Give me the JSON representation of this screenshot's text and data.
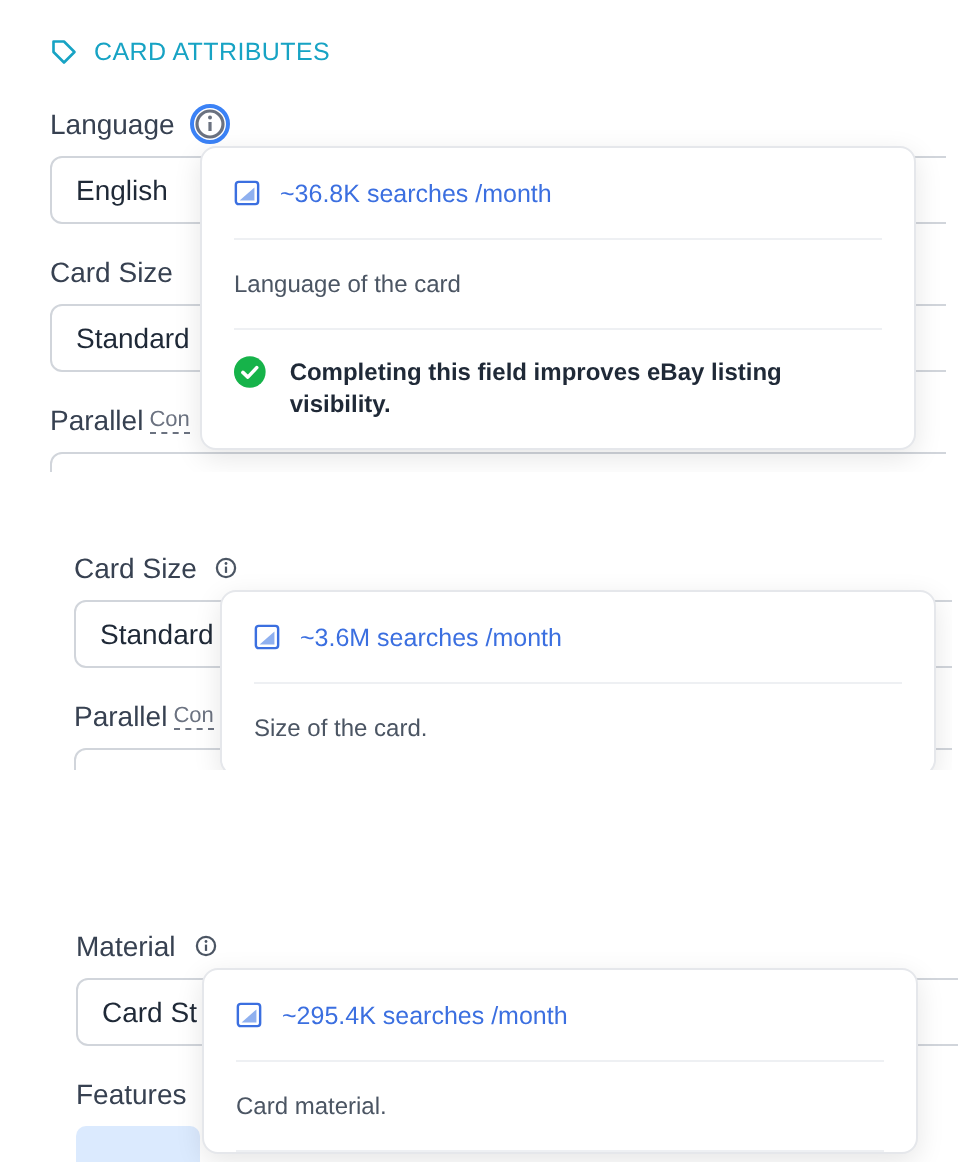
{
  "sections": [
    {
      "heading": "CARD ATTRIBUTES",
      "fields": [
        {
          "label": "Language",
          "info_active": true,
          "value": "English",
          "popover": {
            "searches": "~36.8K searches /month",
            "description": "Language of the card",
            "note": "Completing this field improves eBay listing visibility."
          }
        },
        {
          "label": "Card Size",
          "value": "Standard"
        },
        {
          "label": "Parallel",
          "hint": "Con"
        }
      ]
    },
    {
      "fields": [
        {
          "label": "Card Size",
          "info_active": false,
          "value": "Standard",
          "popover": {
            "searches": "~3.6M searches /month",
            "description": "Size of the card."
          }
        },
        {
          "label": "Parallel",
          "hint": "Con"
        }
      ]
    },
    {
      "fields": [
        {
          "label": "Material",
          "info_active": false,
          "value": "Card St",
          "popover": {
            "searches": "~295.4K searches /month",
            "description": "Card material."
          }
        },
        {
          "label": "Features",
          "kind": "chips"
        }
      ]
    }
  ]
}
